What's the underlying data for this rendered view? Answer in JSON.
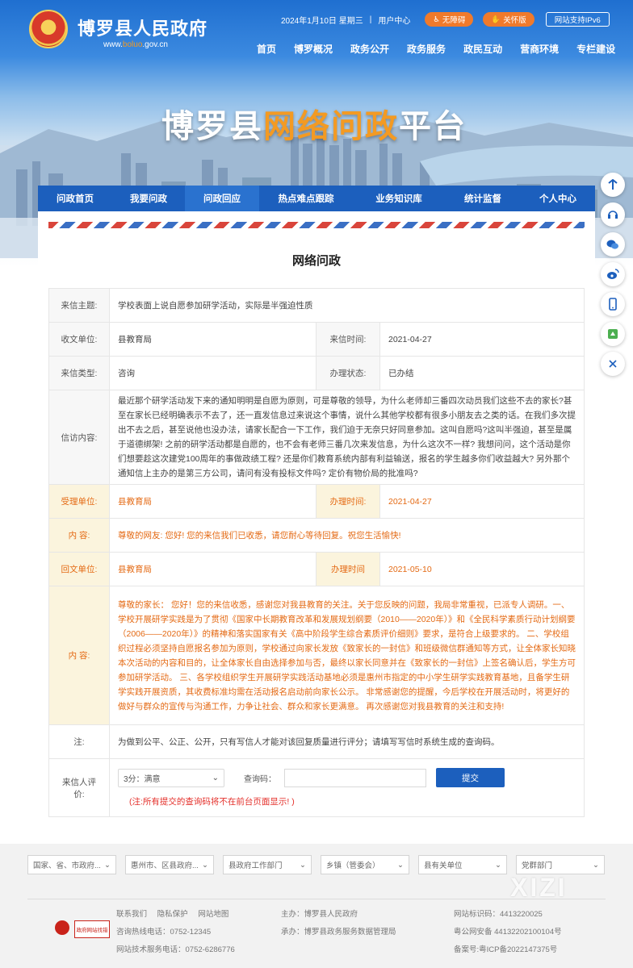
{
  "header": {
    "site_name": "博罗县人民政府",
    "url_prefix": "www.",
    "url_highlight": "boluo",
    "url_suffix": ".gov.cn",
    "date": "2024年1月10日 星期三",
    "divider": "|",
    "user_center": "用户中心",
    "accessibility_label": "无障碍",
    "elder_mode_label": "关怀版",
    "ipv6_label": "网站支持IPv6",
    "nav": [
      "首页",
      "博罗概况",
      "政务公开",
      "政务服务",
      "政民互动",
      "营商环境",
      "专栏建设"
    ]
  },
  "banner": {
    "title_part1": "博罗县",
    "title_highlight": "网络问政",
    "title_part2": "平台"
  },
  "tabs": [
    {
      "label": "问政首页",
      "active": false
    },
    {
      "label": "我要问政",
      "active": false
    },
    {
      "label": "问政回应",
      "active": true
    },
    {
      "label": "热点难点跟踪",
      "active": false
    },
    {
      "label": "业务知识库",
      "active": false
    },
    {
      "label": "统计监督",
      "active": false
    },
    {
      "label": "个人中心",
      "active": false
    }
  ],
  "page_title": "网络问政",
  "detail": {
    "subject_label": "来信主题:",
    "subject": "学校表面上说自愿参加研学活动，实际是半强迫性质",
    "receiver_label": "收文单位:",
    "receiver": "县教育局",
    "date_label": "来信时间:",
    "date": "2021-04-27",
    "type_label": "来信类型:",
    "type": "咨询",
    "status_label": "办理状态:",
    "status": "已办结",
    "content_label": "信访内容:",
    "content": "最近那个研学活动发下来的通知明明是自愿为原则，可是尊敬的领导，为什么老师却三番四次动员我们这些不去的家长?甚至在家长已经明确表示不去了，还一直发信息过来说这个事情，说什么其他学校都有很多小朋友去之类的话。在我们多次提出不去之后，甚至说他也没办法，请家长配合一下工作，我们迫于无奈只好同意参加。这叫自愿吗?这叫半强迫，甚至是属于道德绑架! 之前的研学活动都是自愿的，也不会有老师三番几次来发信息，为什么这次不一样? 我想问问，这个活动是你们想要趁这次建党100周年的事做政绩工程? 还是你们教育系统内部有利益输送，报名的学生越多你们收益越大? 另外那个通知信上主办的是第三方公司，请问有没有投标文件吗? 定价有物价局的批准吗?",
    "handler_label": "受理单位:",
    "handler": "县教育局",
    "handle_time_label": "办理时间:",
    "handle_time": "2021-04-27",
    "ack_label": "内 容:",
    "ack": "尊敬的网友: 您好! 您的来信我们已收悉，请您耐心等待回复。祝您生活愉快!",
    "reply_unit_label": "回文单位:",
    "reply_unit": "县教育局",
    "reply_time_label": "办理时间",
    "reply_time": "2021-05-10",
    "reply_label": "内 容:",
    "reply": "尊敬的家长： 您好！您的来信收悉，感谢您对我县教育的关注。关于您反映的问题，我局非常重视，已派专人调研。一、学校开展研学实践是为了贯彻《国家中长期教育改革和发展规划纲要（2010——2020年）》和《全民科学素质行动计划纲要（2006——2020年）》的精神和落实国家有关《高中阶段学生综合素质评价细则》要求，是符合上级要求的。 二、学校组织过程必须坚持自愿报名参加为原则，学校通过向家长发放《致家长的一封信》和班级微信群通知等方式，让全体家长知晓本次活动的内容和目的，让全体家长自由选择参加与否，最终以家长同意并在《致家长的一封信》上签名确认后，学生方可参加研学活动。 三、各学校组织学生开展研学实践活动基地必须是惠州市指定的中小学生研学实践教育基地，且备学生研学实践开展资质，其收费标准均需在活动报名启动前向家长公示。 非常感谢您的提醒，今后学校在开展活动时，将更好的做好与群众的宣传与沟通工作，力争让社会、群众和家长更满意。 再次感谢您对我县教育的关注和支持!",
    "note_label": "注:",
    "note": "为做到公平、公正、公开，只有写信人才能对该回复质量进行评分；请填写写信时系统生成的查询码。",
    "eval_label": "来信人评价:",
    "eval_selected": "3分：满意",
    "code_label": "查询码：",
    "code_value": "",
    "submit_label": "提交",
    "eval_note": "(注:所有提交的查询码将不在前台页面显示! )"
  },
  "footer": {
    "link_selects": [
      "国家、省、市政府...",
      "惠州市、区县政府...",
      "县政府工作部门",
      "乡镇（管委会）",
      "县有关单位",
      "党群部门"
    ],
    "links": [
      "联系我们",
      "隐私保护",
      "网站地图"
    ],
    "hotline": "咨询热线电话：0752-12345",
    "tech_hotline": "网站技术服务电话：0752-6286776",
    "sponsor": "主办：博罗县人民政府",
    "organizer": "承办：博罗县政务服务数据管理局",
    "site_code": "网站标识码：4413220025",
    "police_record": "粤公网安备 44132202100104号",
    "icp": "备案号:粤ICP备2022147375号",
    "badge_text": "政府网站找错",
    "watermark": "XIZI"
  },
  "colors": {
    "primary": "#1c5fbd",
    "accent": "#f07a2b",
    "reply_text": "#e46a14",
    "reply_bg": "#fbf4dd",
    "alert": "#e4302b"
  },
  "side_icons": [
    "back-to-top-icon",
    "customer-service-icon",
    "wechat-icon",
    "weibo-icon",
    "mobile-icon",
    "app-icon",
    "close-icon"
  ]
}
